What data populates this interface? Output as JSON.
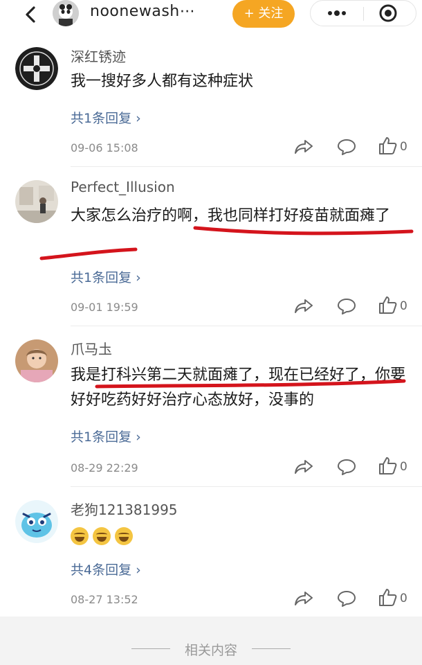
{
  "header": {
    "username": "noonewash⋯",
    "follow_label": "+ 关注",
    "icons": [
      "back-icon",
      "more-icon",
      "target-icon"
    ]
  },
  "comments": [
    {
      "username": "深红锈迹",
      "text": "我一搜好多人都有这种症状",
      "replies": "共1条回复 ›",
      "time": "09-06 15:08",
      "likes": "0"
    },
    {
      "username": "Perfect_Illusion",
      "text": "大家怎么治疗的啊，我也同样打好疫苗就面瘫了",
      "replies": "共1条回复 ›",
      "time": "09-01 19:59",
      "likes": "0"
    },
    {
      "username": "爪马圡",
      "text": "我是打科兴第二天就面瘫了，现在已经好了，你要好好吃药好好治疗心态放好，没事的",
      "replies": "共1条回复 ›",
      "time": "08-29 22:29",
      "likes": "0"
    },
    {
      "username": "老狗121381995",
      "emoji_count": 3,
      "replies": "共4条回复 ›",
      "time": "08-27 13:52",
      "likes": "0"
    }
  ],
  "footer": {
    "label": "相关内容"
  },
  "colors": {
    "accent": "#f5a623",
    "reply_link": "#4a6a96",
    "annotation": "#d4141c"
  }
}
